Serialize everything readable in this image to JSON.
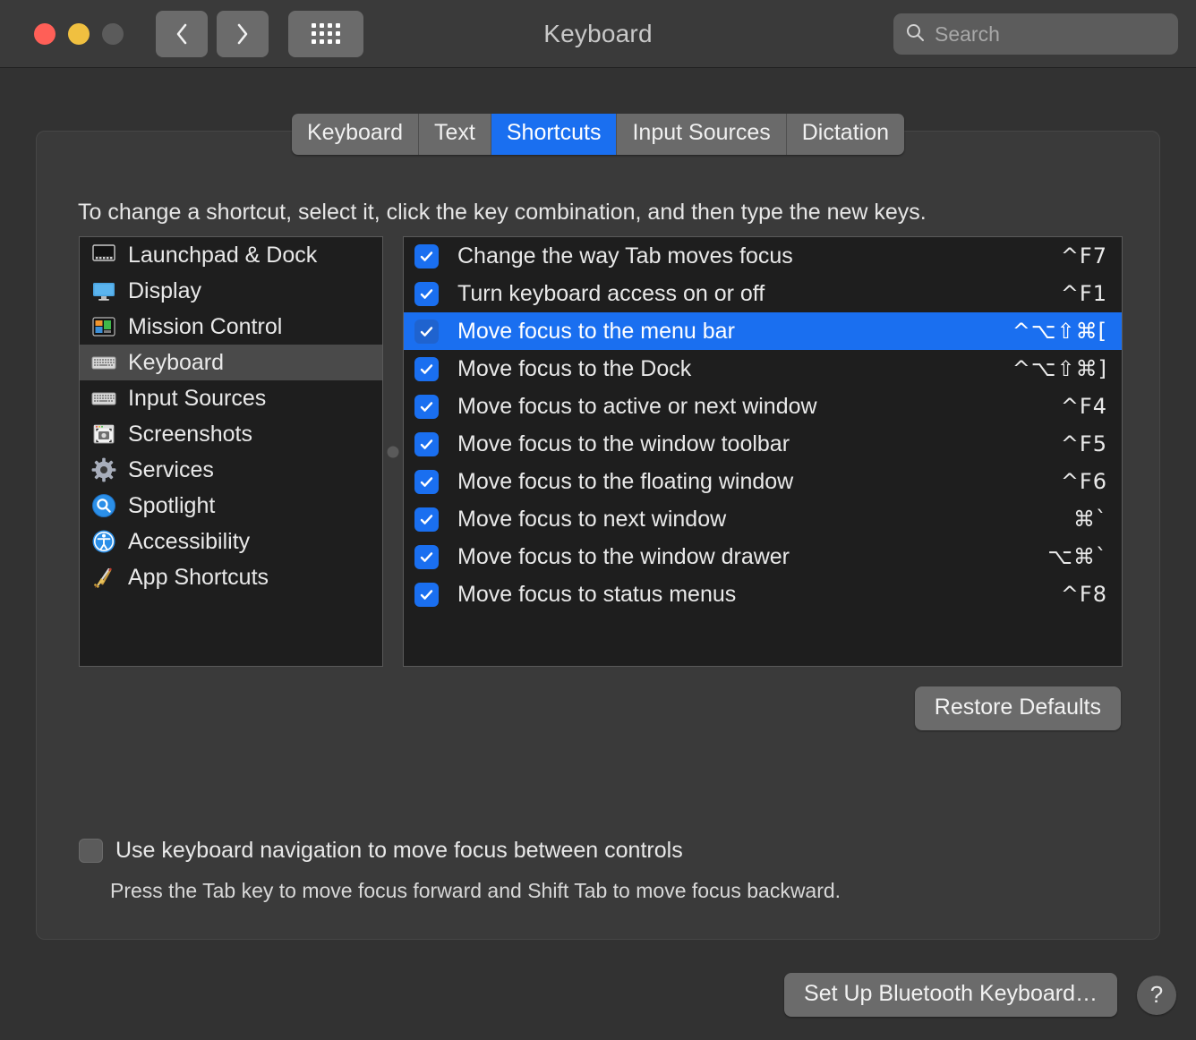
{
  "window": {
    "title": "Keyboard",
    "traffic_lights": [
      "close",
      "minimize",
      "zoom"
    ],
    "nav": {
      "back": "‹",
      "forward": "›",
      "grid": "show-all"
    }
  },
  "search": {
    "value": "",
    "placeholder": "Search",
    "icon": "search-icon"
  },
  "tabs": [
    {
      "label": "Keyboard",
      "active": false
    },
    {
      "label": "Text",
      "active": false
    },
    {
      "label": "Shortcuts",
      "active": true
    },
    {
      "label": "Input Sources",
      "active": false
    },
    {
      "label": "Dictation",
      "active": false
    }
  ],
  "hint": "To change a shortcut, select it, click the key combination, and then type the new keys.",
  "sidebar": {
    "items": [
      {
        "label": "Launchpad & Dock",
        "icon": "launchpad-dock-icon",
        "selected": false
      },
      {
        "label": "Display",
        "icon": "display-icon",
        "selected": false
      },
      {
        "label": "Mission Control",
        "icon": "mission-control-icon",
        "selected": false
      },
      {
        "label": "Keyboard",
        "icon": "keyboard-icon",
        "selected": true
      },
      {
        "label": "Input Sources",
        "icon": "input-sources-icon",
        "selected": false
      },
      {
        "label": "Screenshots",
        "icon": "screenshots-icon",
        "selected": false
      },
      {
        "label": "Services",
        "icon": "services-gear-icon",
        "selected": false
      },
      {
        "label": "Spotlight",
        "icon": "spotlight-icon",
        "selected": false
      },
      {
        "label": "Accessibility",
        "icon": "accessibility-icon",
        "selected": false
      },
      {
        "label": "App Shortcuts",
        "icon": "app-shortcuts-icon",
        "selected": false
      }
    ]
  },
  "shortcuts": {
    "rows": [
      {
        "label": "Change the way Tab moves focus",
        "keys": "^F7",
        "checked": true,
        "selected": false
      },
      {
        "label": "Turn keyboard access on or off",
        "keys": "^F1",
        "checked": true,
        "selected": false
      },
      {
        "label": "Move focus to the menu bar",
        "keys": "^⌥⇧⌘[",
        "checked": true,
        "selected": true
      },
      {
        "label": "Move focus to the Dock",
        "keys": "^⌥⇧⌘]",
        "checked": true,
        "selected": false
      },
      {
        "label": "Move focus to active or next window",
        "keys": "^F4",
        "checked": true,
        "selected": false
      },
      {
        "label": "Move focus to the window toolbar",
        "keys": "^F5",
        "checked": true,
        "selected": false
      },
      {
        "label": "Move focus to the floating window",
        "keys": "^F6",
        "checked": true,
        "selected": false
      },
      {
        "label": "Move focus to next window",
        "keys": "⌘`",
        "checked": true,
        "selected": false
      },
      {
        "label": "Move focus to the window drawer",
        "keys": "⌥⌘`",
        "checked": true,
        "selected": false
      },
      {
        "label": "Move focus to status menus",
        "keys": "^F8",
        "checked": true,
        "selected": false
      }
    ]
  },
  "buttons": {
    "restore_defaults": "Restore Defaults",
    "bluetooth_keyboard": "Set Up Bluetooth Keyboard…",
    "help": "?"
  },
  "keyboard_navigation": {
    "label": "Use keyboard navigation to move focus between controls",
    "checked": false,
    "note": "Press the Tab key to move focus forward and Shift Tab to move focus backward."
  },
  "colors": {
    "accent": "#1a6ff0",
    "window_bg": "#323232",
    "panel_bg": "#3a3a3a",
    "list_bg": "#1e1e1e",
    "selected_sidebar": "#4a4a4a"
  }
}
